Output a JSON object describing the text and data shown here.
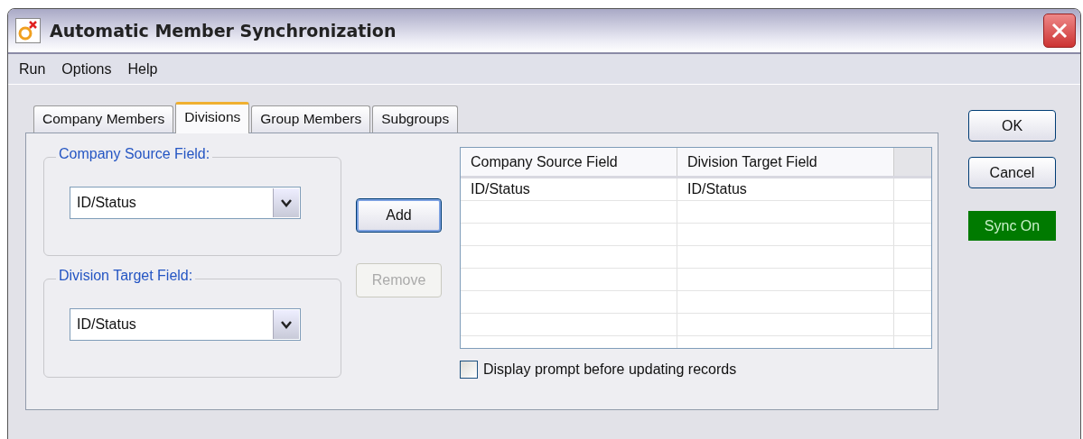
{
  "window": {
    "title": "Automatic Member Synchronization"
  },
  "menu": [
    "Run",
    "Options",
    "Help"
  ],
  "tabs": [
    {
      "label": "Company Members",
      "selected": false
    },
    {
      "label": "Divisions",
      "selected": true
    },
    {
      "label": "Group Members",
      "selected": false
    },
    {
      "label": "Subgroups",
      "selected": false
    }
  ],
  "groups": [
    {
      "legend": "Company Source Field:",
      "value": "ID/Status"
    },
    {
      "legend": "Division Target Field:",
      "value": "ID/Status"
    }
  ],
  "mid_buttons": [
    {
      "label": "Add",
      "disabled": false,
      "default": true
    },
    {
      "label": "Remove",
      "disabled": true,
      "default": false
    }
  ],
  "table": {
    "columns": [
      "Company Source Field",
      "Division Target Field"
    ],
    "rows": [
      [
        "ID/Status",
        "ID/Status"
      ]
    ]
  },
  "prompt_checkbox": {
    "label": "Display prompt before updating records",
    "checked": false
  },
  "buttons": [
    "OK",
    "Cancel"
  ],
  "sync_status": {
    "label": "Sync On",
    "on": true
  }
}
